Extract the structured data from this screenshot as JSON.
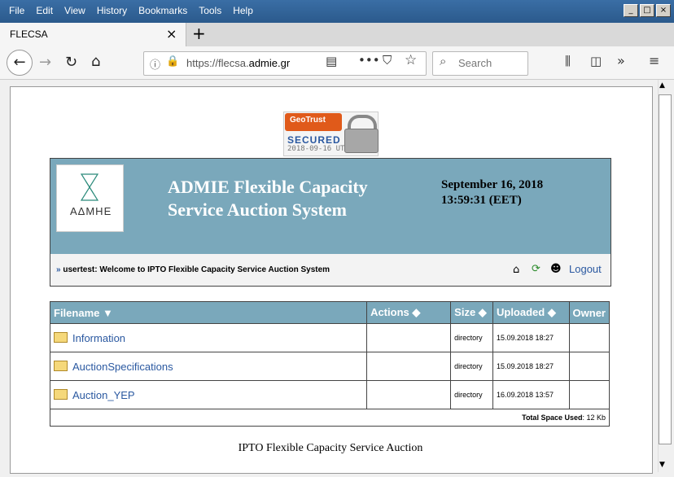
{
  "window": {
    "menu": [
      "File",
      "Edit",
      "View",
      "History",
      "Bookmarks",
      "Tools",
      "Help"
    ],
    "controls": [
      "_",
      "□",
      "×"
    ]
  },
  "tab": {
    "title": "FLECSA",
    "close": "×",
    "new_tab": "+"
  },
  "toolbar": {
    "url_prefix": "https://flecsa.",
    "url_domain": "admie.gr",
    "search_placeholder": "Search",
    "icons": [
      "back-icon",
      "forward-icon",
      "reload-icon",
      "home-icon",
      "info-icon",
      "lock-icon",
      "reader-icon",
      "more-icon",
      "pocket-icon",
      "bookmark-star-icon",
      "search-icon",
      "library-icon",
      "sidebar-icon",
      "overflow-icon",
      "menu-icon"
    ]
  },
  "badge": {
    "brand": "GeoTrust",
    "secured": "SECURED",
    "date": "2018-09-16 UTC"
  },
  "header": {
    "logo_text": "ΑΔΜΗΕ",
    "title": "ADMIE Flexible Capacity Service Auction System",
    "datetime": "September 16, 2018 13:59:31 (EET)"
  },
  "welcome": {
    "arrow": "»",
    "message": "usertest: Welcome to IPTO Flexible Capacity Service Auction System",
    "logout": "Logout"
  },
  "table": {
    "columns": [
      "Filename ▼",
      "Actions ◆",
      "Size ◆",
      "Uploaded ◆",
      "Owner"
    ],
    "rows": [
      {
        "name": "Information",
        "size": "directory",
        "uploaded": "15.09.2018 18:27"
      },
      {
        "name": "AuctionSpecifications",
        "size": "directory",
        "uploaded": "15.09.2018 18:27"
      },
      {
        "name": "Auction_YEP",
        "size": "directory",
        "uploaded": "16.09.2018 13:57"
      }
    ],
    "total_label": "Total Space Used",
    "total_value": ": 12 Kb"
  },
  "footer": "IPTO Flexible Capacity Service Auction"
}
